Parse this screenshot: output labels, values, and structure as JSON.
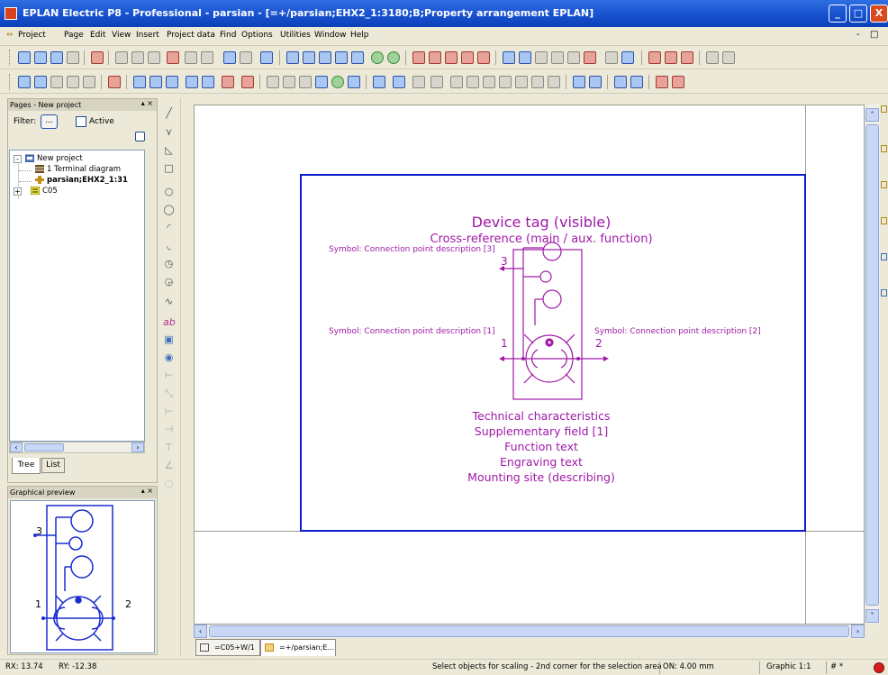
{
  "window": {
    "title": "EPLAN Electric P8 - Professional - parsian - [=+/parsian;EHX2_1:3180;B;Property arrangement EPLAN]",
    "minimize_symbol": "_",
    "maximize_symbol": "□",
    "close_symbol": "X"
  },
  "menubar": {
    "items": [
      "Project",
      "Page",
      "Edit",
      "View",
      "Insert",
      "Project data",
      "Find",
      "Options",
      "Utilities",
      "Window",
      "Help"
    ],
    "mdi_controls": [
      "-",
      "□"
    ]
  },
  "pages_panel": {
    "title": "Pages - New project",
    "controls": "▴ ×",
    "filter_label": "Filter:",
    "filter_button": "...",
    "active_label": "Active",
    "tree": [
      {
        "label": "New project",
        "level": 0,
        "expander": "-",
        "icon": "project-icon",
        "bold": false
      },
      {
        "label": "1 Terminal diagram",
        "level": 1,
        "expander": "",
        "icon": "terminal-diagram-icon",
        "bold": false
      },
      {
        "label": "parsian;EHX2_1:31",
        "level": 1,
        "expander": "",
        "icon": "macro-page-icon",
        "bold": true
      },
      {
        "label": "C05",
        "level": 1,
        "expander": "+",
        "icon": "folder-c05-icon",
        "bold": false
      }
    ],
    "tabs": [
      "Tree",
      "List"
    ]
  },
  "preview_panel": {
    "title": "Graphical preview",
    "controls": "▴ ×",
    "labels": {
      "top": "3",
      "left": "1",
      "right": "2"
    }
  },
  "canvas": {
    "device_tag": "Device tag (visible)",
    "cross_reference": "Cross-reference (main / aux. function)",
    "conn_desc_3": "Symbol: Connection point description [3]",
    "conn_desc_1": "Symbol: Connection point description [1]",
    "conn_desc_2": "Symbol: Connection point description [2]",
    "pin_3": "3",
    "pin_1": "1",
    "pin_2": "2",
    "technical_characteristics": "Technical characteristics",
    "supplementary_field": "Supplementary field [1]",
    "function_text": "Function text",
    "engraving_text": "Engraving text",
    "mounting_site": "Mounting site (describing)",
    "symbol_color": "#a019a7",
    "page_border_color": "#0a1ccb"
  },
  "doc_tabs": [
    "=C05+W/1",
    "=+/parsian;E..."
  ],
  "statusbar": {
    "rx": "RX: 13.74",
    "ry": "RY: -12.38",
    "message": "Select objects for scaling - 2nd corner for the selection area",
    "on": "ON: 4.00 mm",
    "graphic": "Graphic 1:1",
    "hash": "# *"
  }
}
